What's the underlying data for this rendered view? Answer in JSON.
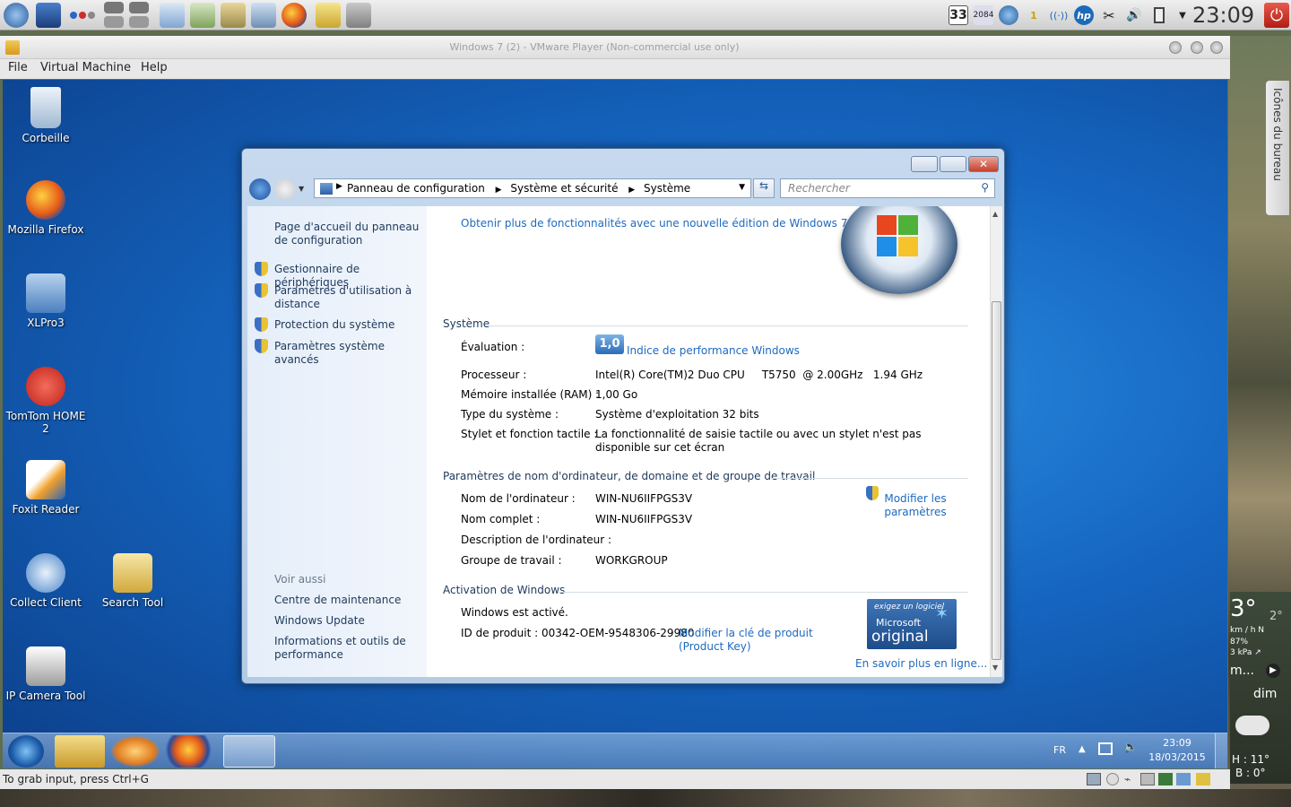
{
  "top_panel": {
    "clock": "23:09",
    "tray": [
      "33",
      "2084",
      "hp"
    ]
  },
  "vmware": {
    "title": "Windows 7 (2) - VMware Player (Non-commercial use only)",
    "menu": [
      "File",
      "Virtual Machine",
      "Help"
    ],
    "status": "To grab input, press Ctrl+G"
  },
  "desktop_icons": [
    {
      "label": "Corbeille"
    },
    {
      "label": "Mozilla Firefox"
    },
    {
      "label": "XLPro3"
    },
    {
      "label": "TomTom HOME 2"
    },
    {
      "label": "Foxit Reader"
    },
    {
      "label": "Collect Client"
    },
    {
      "label": "Search Tool"
    },
    {
      "label": "IP Camera Tool"
    }
  ],
  "explorer": {
    "breadcrumb": [
      "Panneau de configuration",
      "Système et sécurité",
      "Système"
    ],
    "search_placeholder": "Rechercher",
    "left": {
      "home": "Page d'accueil du panneau de configuration",
      "links": [
        "Gestionnaire de périphériques",
        "Paramètres d'utilisation à distance",
        "Protection du système",
        "Paramètres système avancés"
      ],
      "see_also_title": "Voir aussi",
      "see_also": [
        "Centre de maintenance",
        "Windows Update",
        "Informations et outils de performance"
      ]
    },
    "upgrade_link": "Obtenir plus de fonctionnalités avec une nouvelle édition de Windows 7",
    "system": {
      "title": "Système",
      "rating_label": "Évaluation :",
      "rating_value": "1,0",
      "rating_link": "Indice de performance Windows",
      "rows": [
        {
          "label": "Processeur :",
          "value": "Intel(R) Core(TM)2 Duo CPU     T5750  @ 2.00GHz   1.94 GHz"
        },
        {
          "label": "Mémoire installée (RAM) :",
          "value": "1,00 Go"
        },
        {
          "label": "Type du système :",
          "value": "Système d'exploitation 32 bits"
        },
        {
          "label": "Stylet et fonction tactile :",
          "value": "La fonctionnalité de saisie tactile ou avec un stylet n'est pas disponible sur cet écran"
        }
      ]
    },
    "computer": {
      "title": "Paramètres de nom d'ordinateur, de domaine et de groupe de travail",
      "rows": [
        {
          "label": "Nom de l'ordinateur :",
          "value": "WIN-NU6IIFPGS3V"
        },
        {
          "label": "Nom complet :",
          "value": "WIN-NU6IIFPGS3V"
        },
        {
          "label": "Description de l'ordinateur :",
          "value": ""
        },
        {
          "label": "Groupe de travail :",
          "value": "WORKGROUP"
        }
      ],
      "change_link": "Modifier les paramètres"
    },
    "activation": {
      "title": "Activation de Windows",
      "status": "Windows est activé.",
      "product_id": "ID de produit : 00342-OEM-9548306-29980",
      "change_key": "Modifier la clé de produit (Product Key)",
      "genuine_small": "exigez un logiciel",
      "genuine_ms": "Microsoft",
      "genuine_big": "original",
      "learn_more": "En savoir plus en ligne..."
    }
  },
  "taskbar": {
    "lang": "FR",
    "time": "23:09",
    "date": "18/03/2015"
  },
  "host_widget": {
    "tab_label": "Icônes du bureau",
    "temp": "3°",
    "temp_small": "2°",
    "wind": "km / h N",
    "humidity": "87%",
    "pressure": "3 kPa ↗",
    "cond": "m...",
    "day": "dim",
    "high": "H : 11°",
    "low": "B : 0°"
  }
}
